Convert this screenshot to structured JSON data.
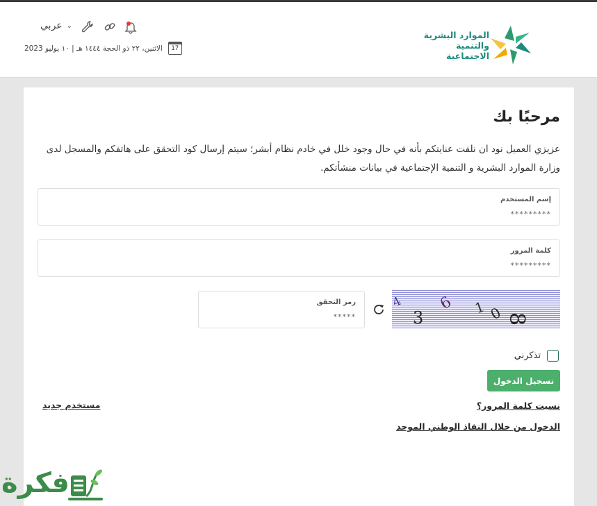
{
  "header": {
    "logo_line1": "الموارد البشرية",
    "logo_line2": "والتنمية الاجتماعية",
    "language_label": "عربي",
    "date_text": "الاثنين، ٢٢ ذو الحجة ١٤٤٤ هـ | ١٠ يوليو 2023",
    "calendar_day": "17"
  },
  "main": {
    "title": "مرحبًا بك",
    "intro": "عزيزي العميل نود ان نلفت عنايتكم بأنه في حال وجود خلل في خادم نظام أبشر؛ سيتم إرسال كود التحقق على هاتفكم والمسجل لدى وزارة الموارد البشرية و التنمية الإجتماعية في بيانات منشأتكم."
  },
  "form": {
    "username_label": "إسم المستخدم",
    "username_value": "*********",
    "password_label": "كلمة المرور",
    "password_value": "*********",
    "captcha_label": "رمز التحقق",
    "captcha_value": "*****",
    "captcha_image_text": "4 3 9 1 0 8",
    "remember_label": "تذكرني",
    "login_button": "تسجيل الدخول"
  },
  "links": {
    "forgot_password": "نسيت كلمة المرور؟",
    "new_user": "مستخدم جديد",
    "nafath_login": "الدخول من خلال النفاذ الوطني الموحد"
  },
  "watermark": {
    "text": "فكرة"
  },
  "colors": {
    "accent_green": "#4caf6c",
    "brand_teal": "#1f8a7e",
    "captcha_lines": "#8b8bd6",
    "notification_dot": "#e53935"
  },
  "icons": [
    "bell-icon",
    "link-icon",
    "wrench-icon",
    "calendar-icon",
    "refresh-icon",
    "chevron-down-icon"
  ]
}
